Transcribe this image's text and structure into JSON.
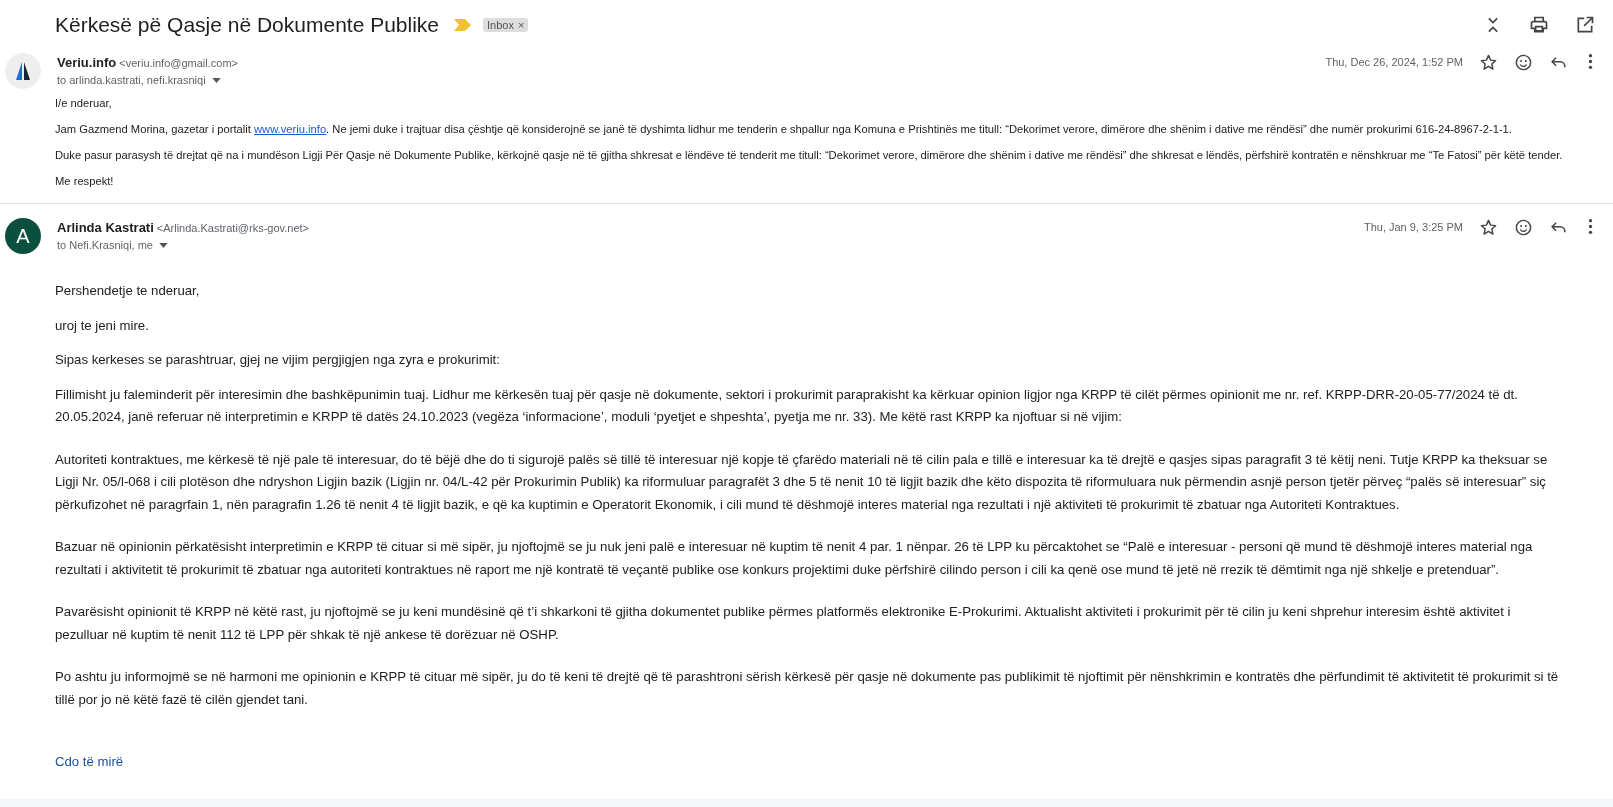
{
  "subject": {
    "title": "Kërkesë pë Qasje në Dokumente Publike",
    "important": true,
    "label": {
      "text": "Inbox",
      "remove": "×"
    }
  },
  "messages": [
    {
      "sender": "Veriu.info",
      "email": "<veriu.info@gmail.com>",
      "to": "to arlinda.kastrati, nefi.krasniqi",
      "avatar": {
        "kind": "logo"
      },
      "date": "Thu, Dec 26, 2024, 1:52 PM",
      "kind": "compact",
      "paragraphs": [
        {
          "kind": "text",
          "text": " I/e nderuar,"
        },
        {
          "kind": "link",
          "before": "Jam Gazmend Morina, gazetar i portalit ",
          "link": "www.veriu.info",
          "after": ". Ne jemi duke i trajtuar disa çështje që konsiderojnë se janë të dyshimta lidhur me tenderin e shpallur nga Komuna e Prishtinës me titull: “Dekorimet verore, dimërore dhe shënim i dative me rëndësi” dhe numër prokurimi 616-24-8967-2-1-1."
        },
        {
          "kind": "text",
          "text": "Duke pasur parasysh të drejtat që na i mundëson Ligji Për Qasje në Dokumente Publike, kërkojnë qasje në të gjitha shkresat e lëndëve të tenderit me titull: “Dekorimet verore, dimërore dhe shënim i dative me rëndësi” dhe shkresat e lëndës, përfshirë kontratën e nënshkruar me “Te Fatosi” për këtë tender."
        },
        {
          "kind": "text",
          "text": "Me respekt!"
        }
      ]
    },
    {
      "sender": "Arlinda Kastrati",
      "email": "<Arlinda.Kastrati@rks-gov.net>",
      "to": "to Nefi.Krasniqi, me",
      "avatar": {
        "kind": "letter",
        "letter": "A",
        "color": "#0b4f3f"
      },
      "date": "Thu, Jan 9, 3:25 PM",
      "kind": "full",
      "paragraphs": [
        {
          "kind": "text",
          "text": "Pershendetje te nderuar,"
        },
        {
          "kind": "text",
          "text": "uroj te jeni mire."
        },
        {
          "kind": "text",
          "text": "Sipas kerkeses se parashtruar, gjej ne vijim pergjigjen nga zyra e prokurimit:"
        },
        {
          "kind": "text",
          "text": "Fillimisht ju faleminderit për interesimin dhe bashkëpunimin tuaj. Lidhur me kërkesën tuaj për qasje në dokumente, sektori i prokurimit paraprakisht ka kërkuar opinion ligjor nga KRPP të cilët përmes opinionit me nr. ref. KRPP-DRR-20-05-77/2024 të dt. 20.05.2024, janë referuar në interpretimin e KRPP të datës 24.10.2023 (vegëza ‘informacione’, moduli ‘pyetjet e shpeshta’, pyetja me nr. 33). Me këtë rast KRPP ka njoftuar si në vijim:"
        },
        {
          "kind": "text",
          "text": "Autoriteti kontraktues, me kërkesë të një pale të interesuar, do të bëjë dhe do ti sigurojë palës së tillë të interesuar një kopje të çfarëdo materiali në të cilin pala e tillë e interesuar ka të drejtë e qasjes sipas paragrafit 3 të këtij neni. Tutje KRPP ka theksuar se Ligji Nr. 05/l-068 i cili plotëson dhe ndryshon Ligjin bazik (Ligjin nr. 04/L-42 për Prokurimin Publik) ka riformuluar paragrafët 3 dhe 5 të nenit 10 të ligjit bazik dhe këto dispozita të riformuluara nuk përmendin asnjë person tjetër përveç “palës së interesuar” siç përkufizohet në paragrfain 1, nën paragrafin 1.26 të nenit 4 të ligjit bazik, e që ka kuptimin e Operatorit Ekonomik, i cili mund të dëshmojë interes material nga rezultati i një aktiviteti të prokurimit të zbatuar nga Autoriteti Kontraktues."
        },
        {
          "kind": "text",
          "text": "Bazuar në opinionin përkatësisht interpretimin e KRPP të cituar si më sipër, ju njoftojmë se ju nuk jeni palë e interesuar në kuptim të nenit 4 par. 1 nënpar. 26 të LPP ku përcaktohet se “Palë e interesuar - personi që mund të dëshmojë interes material nga rezultati i aktivitetit të prokurimit të zbatuar nga autoriteti kontraktues në raport me një kontratë të veçantë publike ose konkurs projektimi duke përfshirë cilindo person i cili ka qenë ose mund të jetë në rrezik të dëmtimit nga një shkelje e pretenduar”."
        },
        {
          "kind": "text",
          "text": "Pavarësisht opinionit të KRPP në këtë rast, ju njoftojmë se ju keni mundësinë që t’i shkarkoni të gjitha dokumentet publike përmes platformës elektronike E-Prokurimi. Aktualisht aktiviteti i prokurimit për të cilin ju keni shprehur interesim është aktivitet i pezulluar në kuptim të nenit 112 të LPP për shkak të një ankese të dorëzuar në OSHP."
        },
        {
          "kind": "text",
          "text": "Po ashtu ju informojmë se në harmoni me opinionin e KRPP të cituar më sipër, ju do të keni të drejtë që të parashtroni sërish kërkesë për qasje në dokumente pas publikimit të njoftimit për nënshkrimin e kontratës dhe përfundimit të aktivitetit të prokurimit si të tillë por jo në këtë fazë të cilën gjendet tani."
        },
        {
          "kind": "closing",
          "text": "Cdo të mirë"
        }
      ]
    }
  ]
}
